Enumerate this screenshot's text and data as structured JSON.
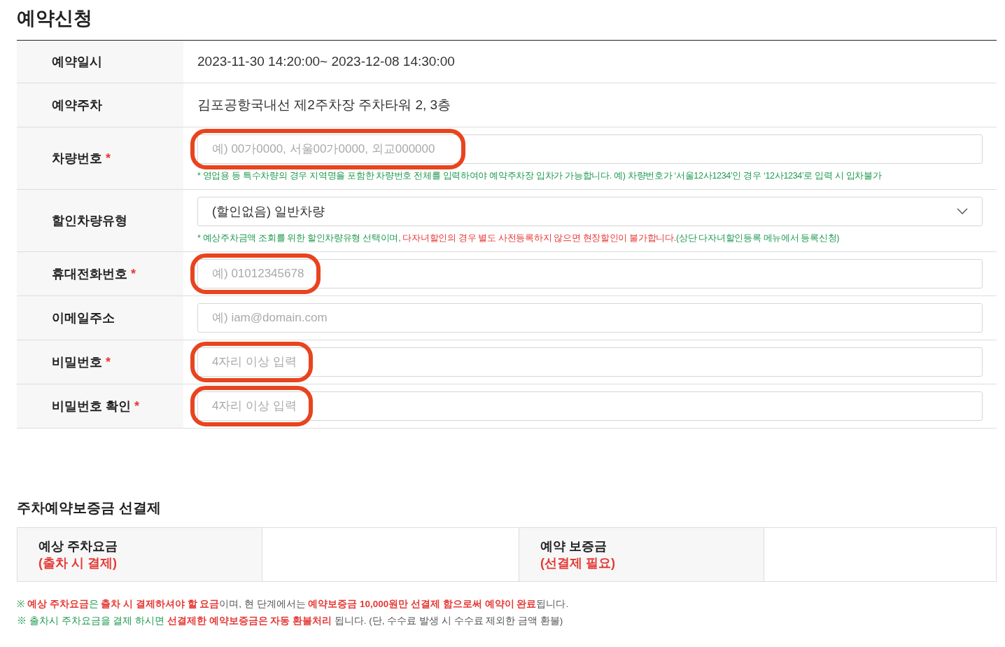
{
  "title": "예약신청",
  "rows": [
    {
      "kind": "text",
      "label": "예약일시",
      "required": false,
      "value": "2023-11-30 14:20:00~ 2023-12-08 14:30:00"
    },
    {
      "kind": "text",
      "label": "예약주차",
      "required": false,
      "value": "김포공항국내선 제2주차장 주차타워 2, 3층"
    },
    {
      "kind": "input",
      "label": "차량번호",
      "required": true,
      "placeholder": "예) 00가0000, 서울00가0000, 외교000000",
      "highlighted": true,
      "hint": [
        {
          "kind": "note",
          "text": "* 영업용 등 특수차량의 경우 지역명을 포함한 차량번호 전체를 입력하여야 예약주차장 입차가 가능합니다. 예) 차량번호가 ‘서울12사1234’인 경우 ‘12사1234’로 입력 시 입차불가"
        }
      ]
    },
    {
      "kind": "select",
      "label": "할인차량유형",
      "required": false,
      "value": "(할인없음) 일반차량",
      "hint": [
        {
          "kind": "note",
          "text": "* 예상주차금액 조회를 위한 할인차량유형 선택이며, "
        },
        {
          "kind": "warning",
          "text": "다자녀할인의 경우 별도 사전등록하지 않으면 현장할인이 불가합니다."
        },
        {
          "kind": "note",
          "text": "(상단 다자녀할인등록 메뉴에서 등록신청)"
        }
      ]
    },
    {
      "kind": "input",
      "label": "휴대전화번호",
      "required": true,
      "placeholder": "예) 01012345678",
      "highlighted": true
    },
    {
      "kind": "input",
      "label": "이메일주소",
      "required": false,
      "placeholder": "예) iam@domain.com",
      "highlighted": false
    },
    {
      "kind": "input",
      "label": "비밀번호",
      "required": true,
      "placeholder": "4자리 이상 입력",
      "highlighted": true
    },
    {
      "kind": "input",
      "label": "비밀번호 확인",
      "required": true,
      "placeholder": "4자리 이상 입력",
      "highlighted": true
    }
  ],
  "required_mark": "*",
  "deposit": {
    "title": "주차예약보증금 선결제",
    "cells": [
      {
        "label": "예상 주차요금",
        "sub": "(출차 시 결제)"
      },
      {
        "label": "예약 보증금",
        "sub": "(선결제 필요)"
      }
    ]
  },
  "notes": [
    [
      {
        "kind": "note",
        "text": "※ "
      },
      {
        "kind": "emphasis",
        "text": "예상 주차요금"
      },
      {
        "kind": "note",
        "text": "은 "
      },
      {
        "kind": "emphasis",
        "text": "출차 시 결제하셔야 할 요금"
      },
      {
        "kind": "plain",
        "text": "이며, 현 단계에서는 "
      },
      {
        "kind": "emphasis",
        "text": "예약보증금 10,000원만 선결제 함으로써 예약이 완료"
      },
      {
        "kind": "plain",
        "text": "됩니다."
      }
    ],
    [
      {
        "kind": "note",
        "text": "※ 출차시 주차요금을 결제 하시면 "
      },
      {
        "kind": "emphasis",
        "text": "선결제한 예약보증금은 자동 환불처리"
      },
      {
        "kind": "plain",
        "text": " 됩니다. (단, 수수료 발생 시 수수료 제외한 금액 환불)"
      }
    ]
  ]
}
